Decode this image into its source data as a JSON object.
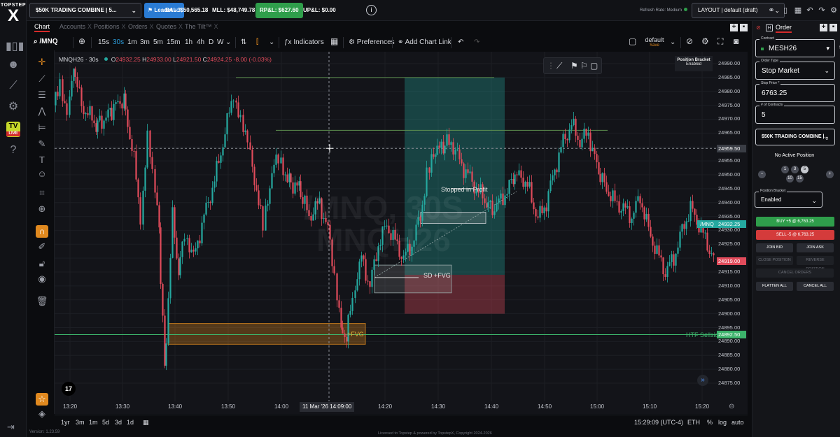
{
  "brand": {
    "name": "TOPSTEP",
    "mark": "X",
    "version": "Version: 1.23.59"
  },
  "topbar": {
    "account": "$50K TRADING COMBINE | 5...",
    "leader": "Leader +3",
    "bal": "BAL: $50,565.18",
    "mll": "MLL: $48,749.78",
    "rpl": "RP&L: $627.60",
    "upl": "UP&L: $0.00",
    "refresh": "Refresh Rate: Medium",
    "layout": "LAYOUT | default (draft)"
  },
  "tabs": [
    {
      "label": "Chart",
      "active": true
    },
    {
      "label": "Accounts",
      "x": "X"
    },
    {
      "label": "Positions",
      "x": "X"
    },
    {
      "label": "Orders",
      "x": "X"
    },
    {
      "label": "Quotes",
      "x": "X"
    },
    {
      "label": "The Tilt™",
      "x": "X"
    }
  ],
  "toolbar": {
    "symbol": "/MNQ",
    "timeframes": [
      "15s",
      "30s",
      "1m",
      "3m",
      "5m",
      "15m",
      "1h",
      "4h",
      "D",
      "W"
    ],
    "active_tf": "30s",
    "indicators": "Indicators",
    "preferences": "Preferences",
    "chart_link": "Add Chart Link",
    "layout_name": "default",
    "layout_save": "Save"
  },
  "legend": {
    "title": "MNQH26 · 30s",
    "o_label": "O",
    "o": "24932.25",
    "h_label": "H",
    "h": "24933.00",
    "l_label": "L",
    "l": "24921.50",
    "c_label": "C",
    "c": "24924.25",
    "chg": "-8.00 (-0.03%)"
  },
  "watermark": {
    "line1": "/MNQ, 30S",
    "line2": "MNQH26"
  },
  "position_bracket": {
    "title": "Position Bracket",
    "status": "Enabled"
  },
  "annotations": {
    "stopped": "Stopped in Profit",
    "sd": "SD +FVG",
    "fvg": "+FVG",
    "htf": "HTF Sellside"
  },
  "yaxis": {
    "ticks": [
      "24990.00",
      "24985.00",
      "24980.00",
      "24975.00",
      "24970.00",
      "24965.00",
      "24955.00",
      "24950.00",
      "24945.00",
      "24940.00",
      "24935.00",
      "24930.00",
      "24925.00",
      "24915.00",
      "24910.00",
      "24905.00",
      "24900.00",
      "24895.00",
      "24890.00",
      "24885.00",
      "24880.00",
      "24875.00"
    ],
    "crosshair_price": "24959.50",
    "last_price": "24919.00",
    "last_label": "/MNQ",
    "last_label_price": "24932.25",
    "htf_price": "24892.50"
  },
  "xaxis": {
    "ticks": [
      "13:20",
      "13:30",
      "13:40",
      "13:50",
      "14:00",
      "14:20",
      "14:30",
      "14:40",
      "14:50",
      "15:00",
      "15:10",
      "15:20"
    ],
    "crosshair": "11 Mar '26  14:09:00"
  },
  "bottom": {
    "ranges": [
      "1yr",
      "3m",
      "1m",
      "5d",
      "3d",
      "1d"
    ],
    "clock": "15:29:09 (UTC-4)",
    "session": "ETH",
    "pct": "%",
    "log": "log",
    "auto": "auto",
    "footer": "Licensed to Topstep & powered by TopstepX, Copyright 2024-2026"
  },
  "order_panel": {
    "tab": "Order",
    "contract_label": "Contract",
    "contract": "MESH26",
    "type_label": "Order Type",
    "type": "Stop Market",
    "stop_label": "Stop Price *",
    "stop": "6763.25",
    "qty_label": "# of Contracts",
    "qty": "5",
    "account": "$50K TRADING COMBINE |...",
    "no_position": "No Active Position",
    "counts": [
      "1",
      "3",
      "5",
      "10",
      "15"
    ],
    "bracket_label": "Position Bracket",
    "bracket": "Enabled",
    "buy": "BUY +5 @ 6,763.25",
    "sell": "SELL -5 @ 6,763.25",
    "join_bid": "JOIN BID",
    "join_ask": "JOIN ASK",
    "close_position": "CLOSE POSITION",
    "reverse_position": "REVERSE POSITION",
    "cancel_orders": "CANCEL ORDERS",
    "flatten_all": "FLATTEN ALL",
    "cancel_all": "CANCEL ALL"
  },
  "colors": {
    "up": "#25a9a0",
    "down": "#e14b5b",
    "buy": "#2f9e4b",
    "sell": "#d43b3b",
    "accent": "#2a7bd3"
  }
}
